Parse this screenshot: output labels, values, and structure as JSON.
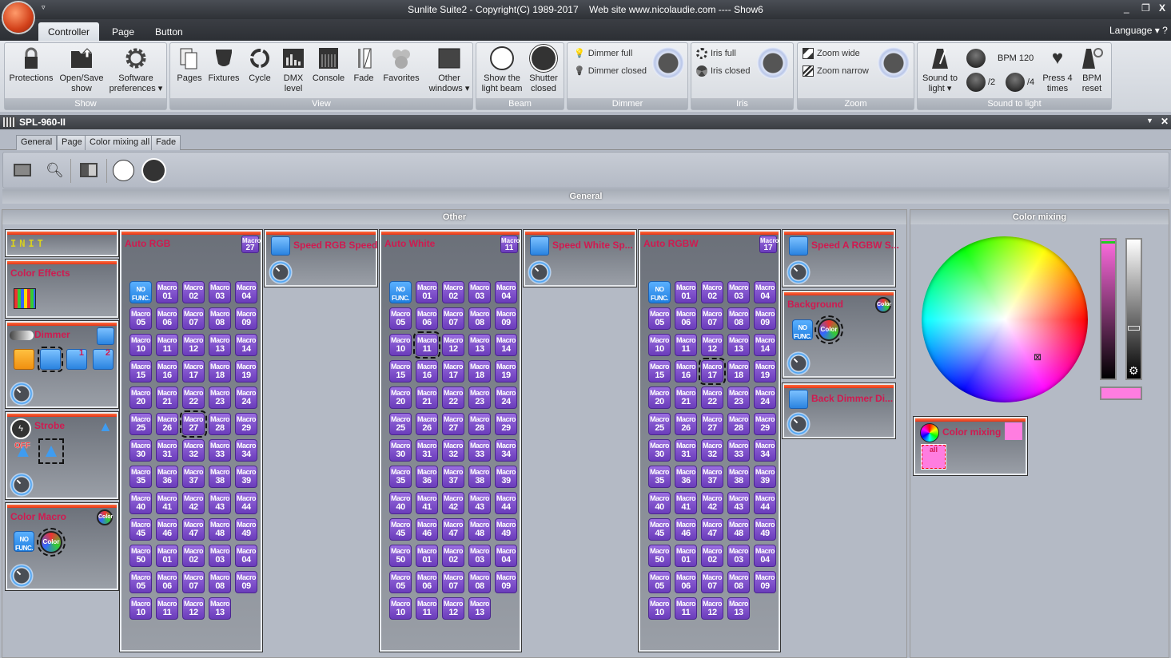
{
  "window": {
    "title": "Sunlite Suite2 - Copyright(C) 1989-2017    Web site www.nicolaudie.com ---- Show6",
    "language": "Language",
    "help": "?"
  },
  "ribbon_tabs": [
    "Controller",
    "Page",
    "Button"
  ],
  "ribbon": {
    "show": {
      "label": "Show",
      "buttons": [
        "Protections",
        "Open/Save show",
        "Software preferences"
      ]
    },
    "view": {
      "label": "View",
      "buttons": [
        "Pages",
        "Fixtures",
        "Cycle",
        "DMX level",
        "Console",
        "Fade",
        "Favorites",
        "Other windows"
      ]
    },
    "beam": {
      "label": "Beam",
      "buttons": [
        "Show the light beam",
        "Shutter closed"
      ]
    },
    "dimmer": {
      "label": "Dimmer",
      "full": "Dimmer full",
      "closed": "Dimmer closed"
    },
    "iris": {
      "label": "Iris",
      "full": "Iris full",
      "closed": "Iris closed"
    },
    "zoom": {
      "label": "Zoom",
      "wide": "Zoom wide",
      "narrow": "Zoom narrow"
    },
    "sound": {
      "label": "Sound to light",
      "sound_to_light": "Sound to light",
      "bpm": "BPM 120",
      "half": "/2",
      "quarter": "/4",
      "press4": "Press 4 times",
      "bpm_reset": "BPM reset"
    }
  },
  "fixture_panel": {
    "title": "SPL-960-II",
    "tabs": [
      "General",
      "Page",
      "Color mixing all",
      "Fade"
    ],
    "section": "General"
  },
  "other": {
    "title": "Other",
    "init": "INIT",
    "color_effects": "Color Effects",
    "dimmer": "Dimmer",
    "dimmer_badges": [
      "1",
      "2"
    ],
    "strobe": "Strobe",
    "strobe_off": "OFF",
    "color_macro": "Color Macro",
    "no_func": "NO FUNC.",
    "color_word": "Color",
    "macro_word": "Macro",
    "macro_numbers": [
      "01",
      "02",
      "03",
      "04",
      "05",
      "06",
      "07",
      "08",
      "09",
      "10",
      "11",
      "12",
      "13",
      "14",
      "15",
      "16",
      "17",
      "18",
      "19",
      "20",
      "21",
      "22",
      "23",
      "24",
      "25",
      "26",
      "27",
      "28",
      "29",
      "30",
      "31",
      "32",
      "33",
      "34",
      "35",
      "36",
      "37",
      "38",
      "39",
      "40",
      "41",
      "42",
      "43",
      "44",
      "45",
      "46",
      "47",
      "48",
      "49",
      "50",
      "01",
      "02",
      "03",
      "04",
      "05",
      "06",
      "07",
      "08",
      "09",
      "10",
      "11",
      "12",
      "13"
    ],
    "macro_groups": [
      {
        "title": "Auto RGB",
        "current": "27",
        "selected_index": 27
      },
      {
        "title": "Auto White",
        "current": "11",
        "selected_index": 11
      },
      {
        "title": "Auto RGBW",
        "current": "17",
        "selected_index": 17
      }
    ],
    "speed_rgb": "Speed RGB Speed",
    "speed_white": "Speed White Sp...",
    "speed_rgbw": "Speed A RGBW S...",
    "background": "Background",
    "back_dimmer": "Back Dimmer Di..."
  },
  "color_mixing": {
    "title": "Color mixing",
    "group": "Color mixing",
    "all": "all",
    "current_color": "#ff7de0",
    "intensity": 0.0,
    "white_level": 0.35
  }
}
